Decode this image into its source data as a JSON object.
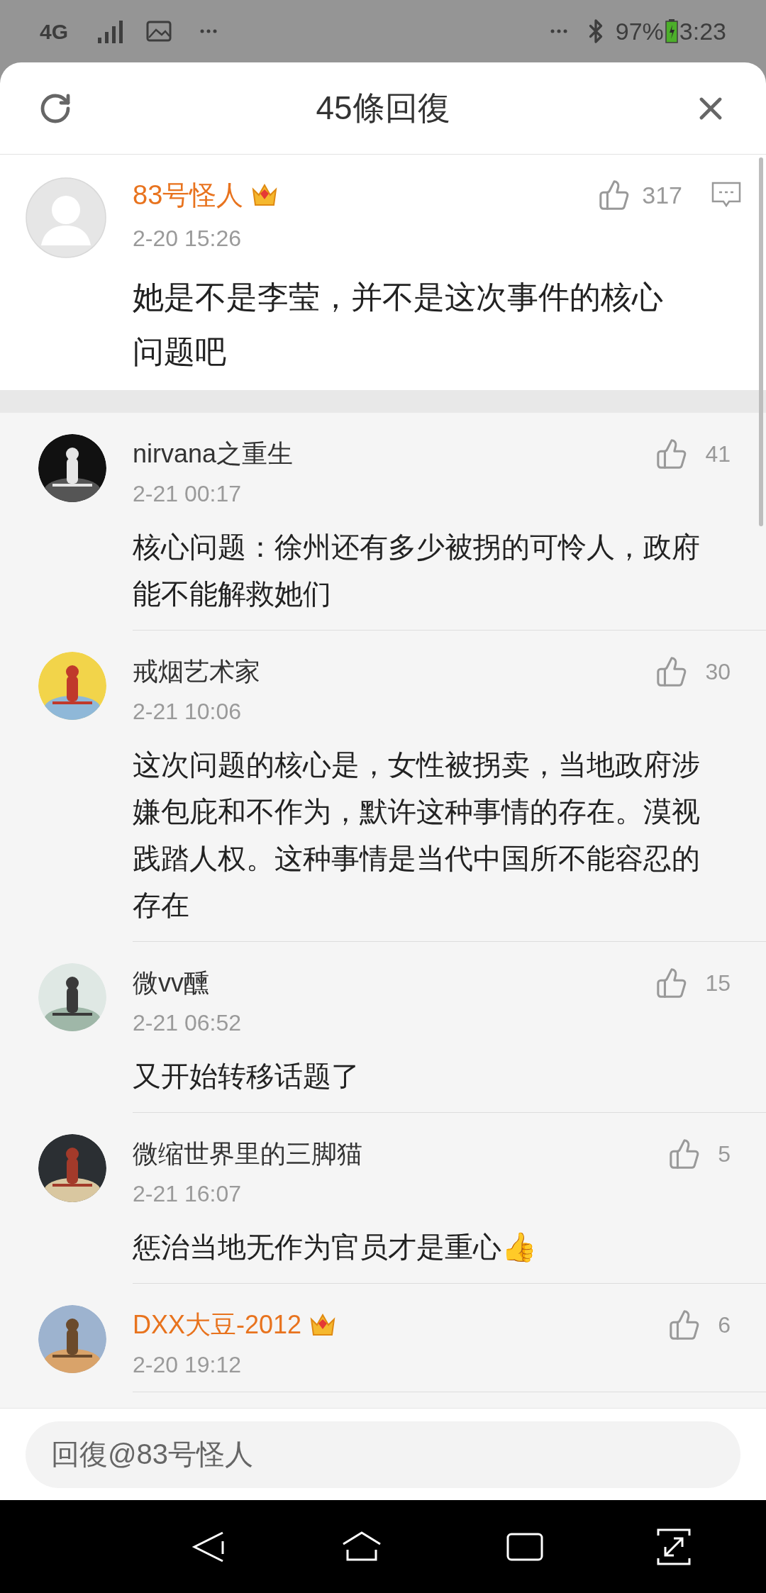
{
  "status_bar": {
    "network": "4G",
    "battery": "97%",
    "time": "3:23"
  },
  "header": {
    "title": "45條回復"
  },
  "main_comment": {
    "author": "83号怪人",
    "vip": true,
    "time": "2-20 15:26",
    "likes": "317",
    "text": "她是不是李莹，并不是这次事件的核心问题吧"
  },
  "replies": [
    {
      "author": "nirvana之重生",
      "vip": false,
      "time": "2-21 00:17",
      "likes": "41",
      "text": "核心问题：徐州还有多少被拐的可怜人，政府能不能解救她们"
    },
    {
      "author": "戒烟艺术家",
      "vip": false,
      "time": "2-21 10:06",
      "likes": "30",
      "text": "这次问题的核心是，女性被拐卖，当地政府涉嫌包庇和不作为，默许这种事情的存在。漠视践踏人权。这种事情是当代中国所不能容忍的存在"
    },
    {
      "author": "微vv醺",
      "vip": false,
      "time": "2-21 06:52",
      "likes": "15",
      "text": "又开始转移话题了"
    },
    {
      "author": "微缩世界里的三脚猫",
      "vip": false,
      "time": "2-21 16:07",
      "likes": "5",
      "text": "惩治当地无作为官员才是重心👍"
    },
    {
      "author": "DXX大豆-2012",
      "vip": true,
      "time": "2-20 19:12",
      "likes": "6"
    }
  ],
  "reply_field": {
    "placeholder": "回復@83号怪人"
  }
}
